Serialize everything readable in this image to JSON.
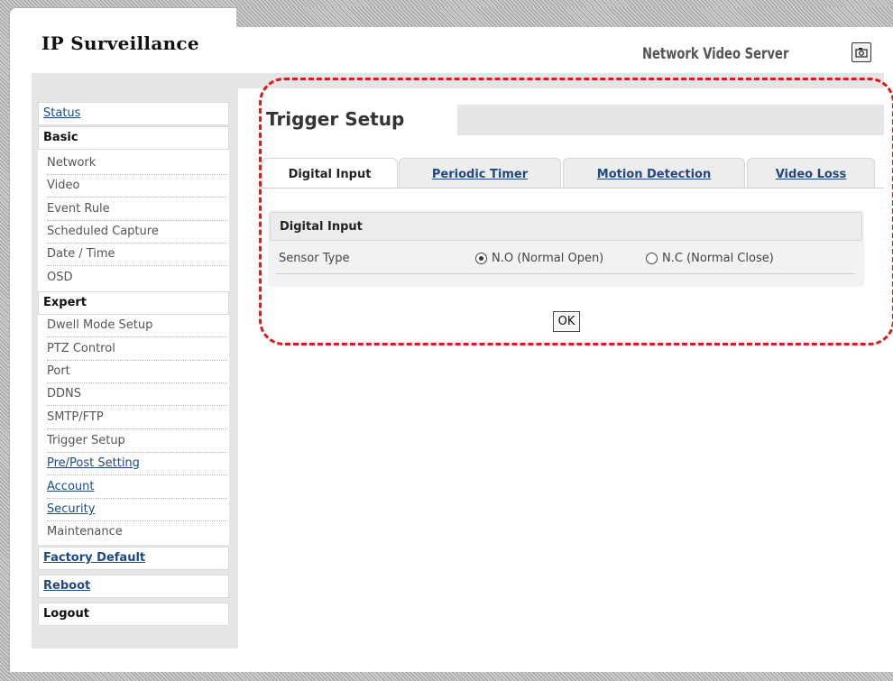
{
  "header": {
    "app_title": "IP Surveillance",
    "product_name": "Network Video Server",
    "snapshot_icon": "camera-snapshot-icon"
  },
  "sidebar": {
    "status": "Status",
    "basic_heading": "Basic",
    "basic_items": [
      "Network",
      "Video",
      "Event Rule",
      "Scheduled Capture",
      "Date / Time",
      "OSD"
    ],
    "expert_heading": "Expert",
    "expert_items": [
      "Dwell Mode Setup",
      "PTZ Control",
      "Port",
      "DDNS",
      "SMTP/FTP",
      "Trigger Setup",
      "Pre/Post Setting",
      "Account",
      "Security",
      "Maintenance"
    ],
    "factory_default": "Factory Default",
    "reboot": "Reboot",
    "logout": "Logout"
  },
  "main": {
    "title": "Trigger Setup",
    "tabs": [
      "Digital Input",
      "Periodic Timer",
      "Motion Detection",
      "Video Loss"
    ],
    "active_tab": "Digital Input",
    "panel_heading": "Digital Input",
    "sensor_label": "Sensor Type",
    "sensor_options": [
      "N.O (Normal Open)",
      "N.C (Normal Close)"
    ],
    "sensor_selected": "N.O (Normal Open)",
    "ok_label": "OK"
  },
  "colors": {
    "link": "#1a4a8a",
    "highlight": "#e3171c",
    "sidebar_bg": "#e6e6e6"
  }
}
